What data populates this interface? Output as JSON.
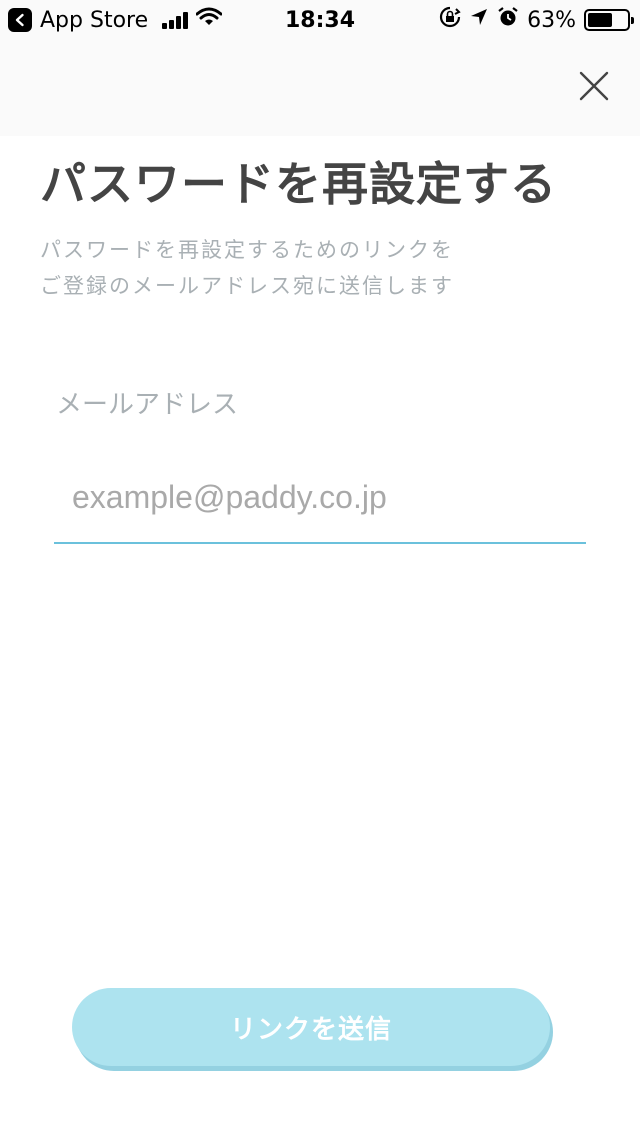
{
  "status_bar": {
    "back_app": "App Store",
    "time": "18:34",
    "battery": "63%",
    "battery_level": 0.63,
    "icons": [
      "back-chevron-icon",
      "signal-icon",
      "wifi-icon",
      "orientation-lock-icon",
      "location-icon",
      "alarm-icon",
      "battery-icon"
    ]
  },
  "header": {
    "close_icon": "close-icon"
  },
  "main": {
    "title": "パスワードを再設定する",
    "subtitle_line1": "パスワードを再設定するためのリンクを",
    "subtitle_line2": "ご登録のメールアドレス宛に送信します",
    "email_label": "メールアドレス",
    "email_placeholder": "example@paddy.co.jp",
    "email_value": "",
    "submit_label": "リンクを送信"
  },
  "colors": {
    "title": "#444444",
    "muted": "#a9b0b4",
    "accent_underline": "#6bc1dc",
    "button_bg": "#ade3ef",
    "button_shadow": "#94d1e1"
  }
}
